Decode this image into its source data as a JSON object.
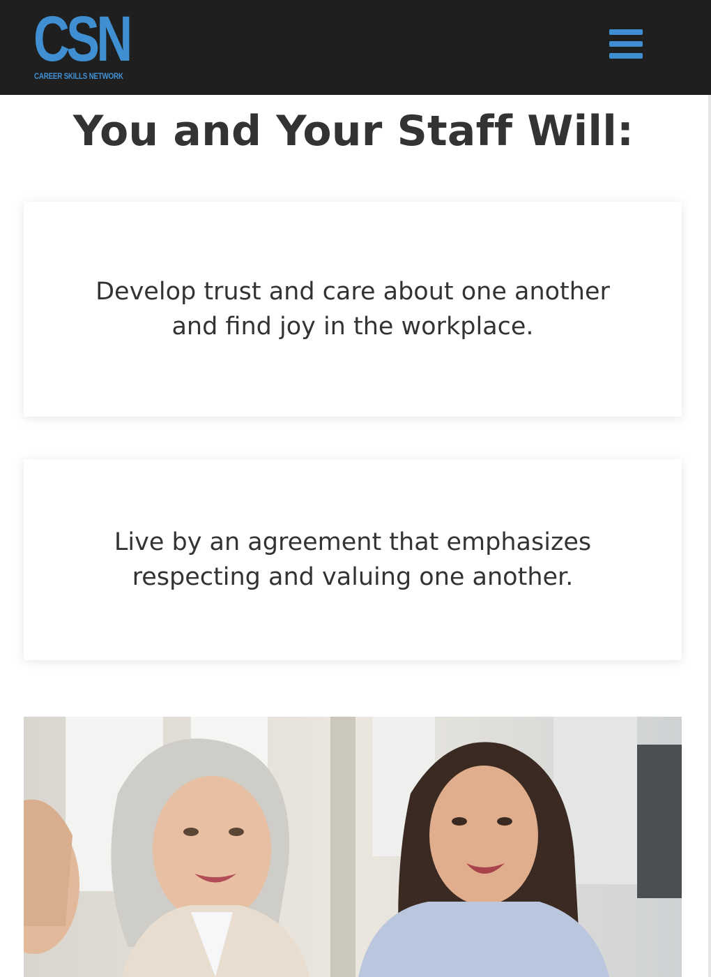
{
  "header": {
    "logo": {
      "letters": "CSN",
      "tagline": "CAREER SKILLS NETWORK"
    },
    "menu_icon": "hamburger-menu-icon",
    "background_color": "#1f1f1f",
    "accent_color": "#3f8fd2"
  },
  "main": {
    "title": "You and Your Staff Will:",
    "cards": [
      {
        "text": "Develop trust and care about one another and find joy in the workplace."
      },
      {
        "text": "Live by an agreement that emphasizes respecting and valuing one another."
      }
    ],
    "photo": {
      "subject": "smiling coworkers in an office"
    }
  }
}
